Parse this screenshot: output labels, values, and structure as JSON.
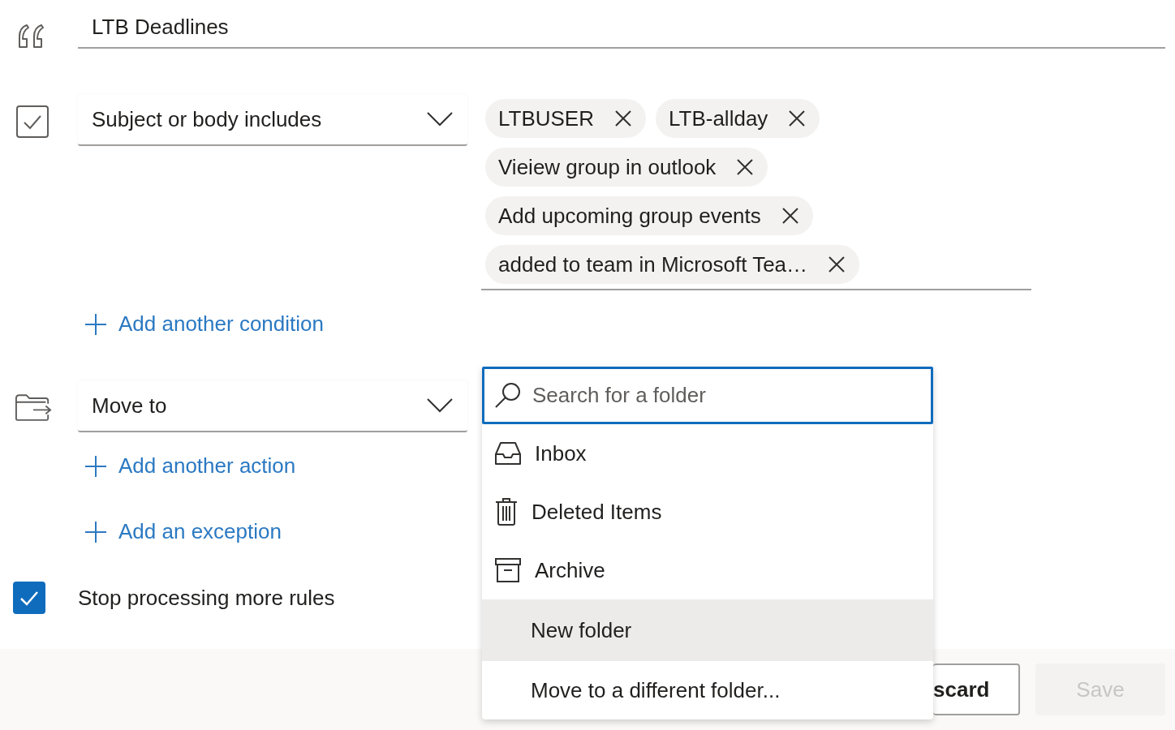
{
  "rule_name": {
    "value": "LTB Deadlines"
  },
  "condition": {
    "field": "Subject or body includes",
    "keywords": [
      {
        "text": "LTBUSER"
      },
      {
        "text": "LTB-allday"
      },
      {
        "text": "Vieiew group in outlook"
      },
      {
        "text": "Add upcoming group events"
      },
      {
        "text": "added to team in Microsoft Tea…"
      }
    ]
  },
  "add_condition": "Add another condition",
  "action": {
    "field": "Move to"
  },
  "add_action": "Add another action",
  "add_exception": "Add an exception",
  "stop_processing": {
    "label": "Stop processing more rules",
    "checked": true
  },
  "folder_menu": {
    "search": {
      "placeholder": "Search for a folder"
    },
    "items": [
      {
        "kind": "inbox",
        "label": "Inbox",
        "selected": false
      },
      {
        "kind": "trash",
        "label": "Deleted Items",
        "selected": false
      },
      {
        "kind": "archive",
        "label": "Archive",
        "selected": false
      },
      {
        "kind": "plain",
        "label": "New folder",
        "selected": true
      },
      {
        "kind": "plain",
        "label": "Move to a different folder...",
        "selected": false
      }
    ]
  },
  "footer": {
    "discard": "scard",
    "save": {
      "label": "Save",
      "disabled": true
    }
  }
}
